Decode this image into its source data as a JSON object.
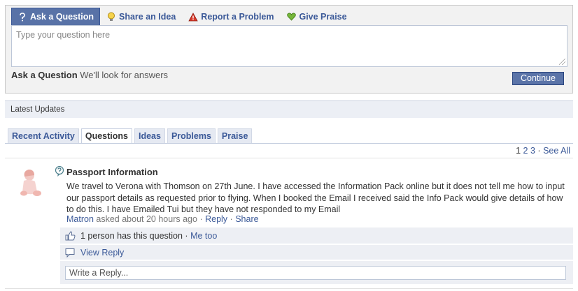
{
  "composer": {
    "tabs": [
      {
        "label": "Ask a Question",
        "icon": "question-icon",
        "active": true
      },
      {
        "label": "Share an Idea",
        "icon": "lightbulb-icon"
      },
      {
        "label": "Report a Problem",
        "icon": "warning-icon"
      },
      {
        "label": "Give Praise",
        "icon": "heart-icon"
      }
    ],
    "placeholder": "Type your question here",
    "footer_title": "Ask a Question",
    "footer_sub": "We'll look for answers",
    "continue_label": "Continue"
  },
  "updates": {
    "title": "Latest Updates",
    "tabs": [
      "Recent Activity",
      "Questions",
      "Ideas",
      "Problems",
      "Praise"
    ],
    "active_tab": "Questions",
    "pager": {
      "current": "1",
      "pages": [
        "2",
        "3"
      ],
      "sep": "·",
      "see_all": "See All"
    }
  },
  "post": {
    "title": "Passport Information",
    "body": "We travel to Verona with Thomson on 27th June. I have accessed the Information Pack online but it does not tell me how to input our passport details as requested prior to flying. When I booked the Email I received said the Info Pack would give details of how to do this. I have Emailed Tui but they have not responded to my Email",
    "author": "Matron",
    "asked": "asked about 20 hours ago",
    "sep": "·",
    "reply_label": "Reply",
    "share_label": "Share",
    "count_text": "1 person has this question",
    "me_too": "Me too",
    "view_reply": "View Reply",
    "reply_placeholder": "Write a Reply..."
  },
  "colors": {
    "brand": "#3b5998",
    "active_tab_bg": "#5872a7",
    "panel_bg": "#edeff4"
  }
}
